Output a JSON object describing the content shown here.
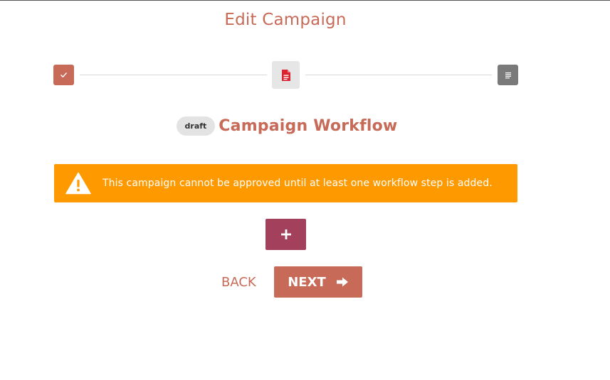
{
  "page": {
    "title": "Edit Campaign"
  },
  "stepper": {
    "steps": [
      {
        "icon": "check-icon",
        "state": "complete",
        "color": "#c76a57"
      },
      {
        "icon": "document-icon",
        "state": "current",
        "color": "#e6e6e6",
        "icon_color": "#d9232e"
      },
      {
        "icon": "list-icon",
        "state": "pending",
        "color": "#7a7a7a"
      }
    ]
  },
  "heading": {
    "status": "draft",
    "title": "Campaign Workflow"
  },
  "alert": {
    "icon": "warning-icon",
    "message": "This campaign cannot be approved until at least one workflow step is added.",
    "color": "#ff9900"
  },
  "actions": {
    "add_icon": "plus-icon",
    "add_color": "#a3415d",
    "back_label": "BACK",
    "next_label": "NEXT",
    "next_icon": "arrow-right-icon",
    "accent": "#c76a57"
  }
}
